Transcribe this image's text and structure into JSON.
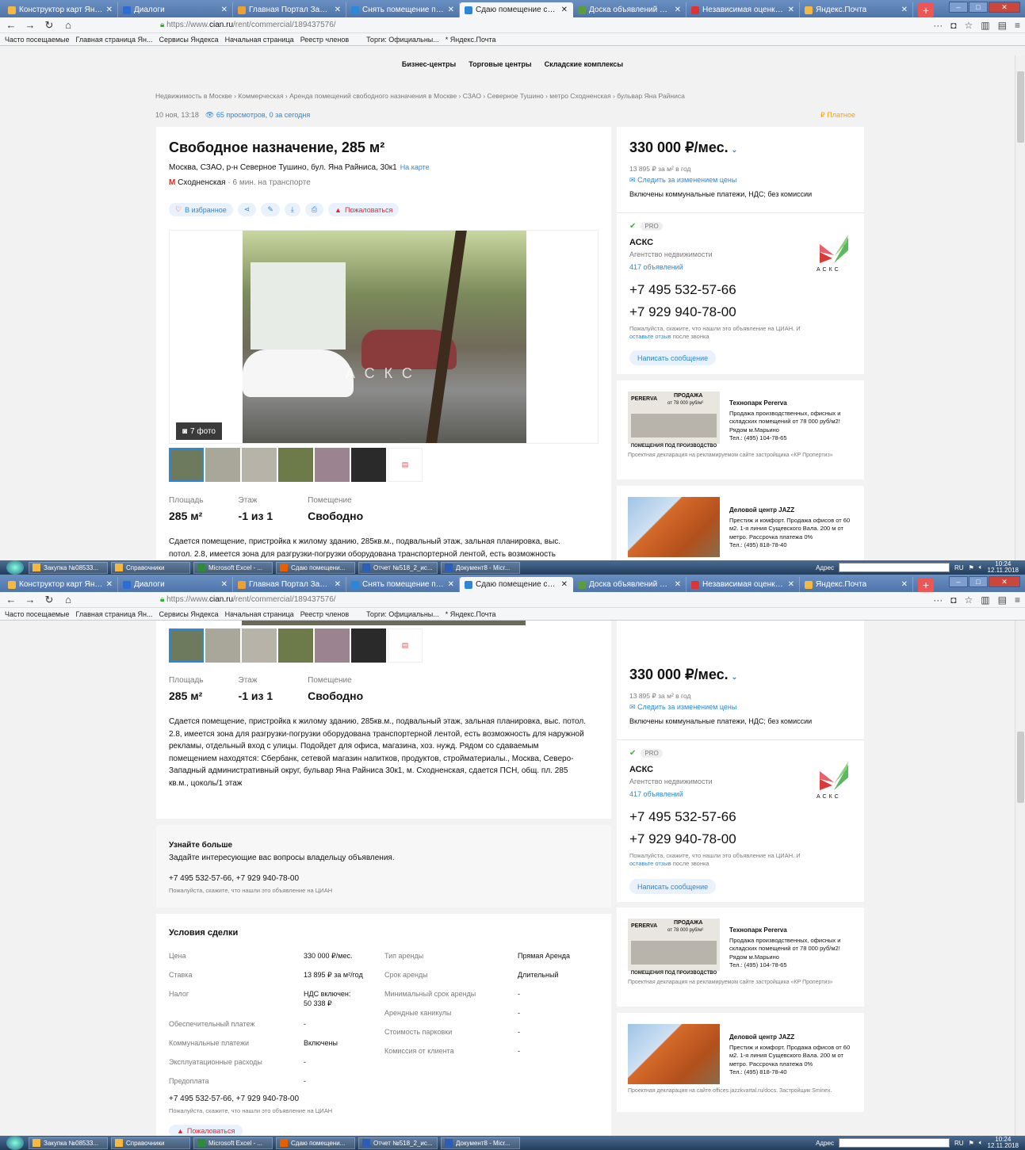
{
  "browser": {
    "tabs": [
      {
        "label": "Конструктор карт Яндекса",
        "color": "#f5b942"
      },
      {
        "label": "Диалоги",
        "color": "#2b6cd6"
      },
      {
        "label": "Главная Портал Закупок",
        "color": "#f0a030"
      },
      {
        "label": "Снять помещение под общ...",
        "color": "#2b87db"
      },
      {
        "label": "Сдаю помещение свободно...",
        "color": "#2b87db"
      },
      {
        "label": "Доска объявлений от частн...",
        "color": "#5a9d3a"
      },
      {
        "label": "Независимая оценка недви...",
        "color": "#d33"
      },
      {
        "label": "Яндекс.Почта",
        "color": "#f5b942"
      }
    ],
    "active_tab": 4,
    "url_prefix": "https://www.",
    "url_domain": "cian.ru",
    "url_path": "/rent/commercial/189437576/",
    "bookmarks": [
      "Часто посещаемые",
      "Главная страница Ян...",
      "Сервисы Яндекса",
      "Начальная страница",
      "Реестр членов",
      "Торги: Официальны...",
      "* Яндекс.Почта"
    ]
  },
  "site_nav": [
    "Бизнес-центры",
    "Торговые центры",
    "Складские комплексы"
  ],
  "breadcrumb": "Недвижимость в Москве  ›  Коммерческая  ›  Аренда помещений свободного назначения в Москве  ›  СЗАО  ›  Северное Тушино  ›  метро Сходненская  ›  бульвар Яна Райниса",
  "meta": {
    "date": "10 ноя, 13:18",
    "views": "65 просмотров, 0 за сегодня",
    "paid": "Платное"
  },
  "listing": {
    "title": "Свободное назначение, 285 м²",
    "address": "Москва, СЗАО, р-н Северное Тушино, бул. Яна Райниса, 30к1",
    "map_link": "На карте",
    "metro": "Сходненская",
    "metro_time": " · 6 мин. на транспорте",
    "actions": {
      "fav": "В избранное",
      "complain": "Пожаловаться"
    },
    "photo_count": "7 фото",
    "watermark": "АСКС",
    "facts": [
      {
        "label": "Площадь",
        "value": "285 м²"
      },
      {
        "label": "Этаж",
        "value": "-1 из 1"
      },
      {
        "label": "Помещение",
        "value": "Свободно"
      }
    ],
    "description_line1": "Сдается помещение, пристройка к жилому зданию, 285кв.м., подвальный этаж, зальная планировка, выс.",
    "description_line2": "потол. 2.8, имеется зона для разгрузки-погрузки оборудована транспортерной лентой, есть возможность",
    "description": "Сдается помещение, пристройка к жилому зданию, 285кв.м., подвальный этаж, зальная планировка, выс. потол. 2.8, имеется зона для разгрузки-погрузки оборудована транспортерной лентой, есть возможность для наружной рекламы, отдельный вход с улицы. Подойдет для офиса, магазина, хоз. нужд. Рядом со сдаваемым помещением находятся: Сбербанк, сетевой магазин напитков, продуктов, стройматериалы., Москва, Северо-Западный административный округ, бульвар Яна Райниса 30к1, м. Сходненская, сдается ПСН, общ. пл. 285 кв.м., цоколь/1 этаж"
  },
  "more_info": {
    "title": "Узнайте больше",
    "text": "Задайте интересующие вас вопросы владельцу объявления.",
    "phones": "+7 495 532-57-66, +7 929 940-78-00",
    "note": "Пожалуйста, скажите, что нашли это объявление на ЦИАН"
  },
  "deal": {
    "title": "Условия сделки",
    "left": [
      {
        "k": "Цена",
        "v": "330 000 ₽/мес."
      },
      {
        "k": "Ставка",
        "v": "13 895 ₽ за м²/год"
      },
      {
        "k": "Налог",
        "v": "НДС включен:",
        "v2": "50 338 ₽"
      },
      {
        "k": "Обеспечительный платеж",
        "v": "-"
      },
      {
        "k": "Коммунальные платежи",
        "v": "Включены"
      },
      {
        "k": "Эксплуатационные расходы",
        "v": "-"
      },
      {
        "k": "Предоплата",
        "v": "-"
      }
    ],
    "right": [
      {
        "k": "Тип аренды",
        "v": "Прямая Аренда"
      },
      {
        "k": "Срок аренды",
        "v": "Длительный"
      },
      {
        "k": "Минимальный срок аренды",
        "v": "-"
      },
      {
        "k": "Арендные каникулы",
        "v": "-"
      },
      {
        "k": "Стоимость парковки",
        "v": "-"
      },
      {
        "k": "Комиссия от клиента",
        "v": "-"
      }
    ],
    "phones": "+7 495 532-57-66, +7 929 940-78-00",
    "note": "Пожалуйста, скажите, что нашли это объявление на ЦИАН",
    "complain": "Пожаловаться"
  },
  "sidebar": {
    "price": "330 000 ₽/мес.",
    "per_m2": "13 895 ₽ за м² в год",
    "watch": "Следить за изменением цены",
    "included": "Включены коммунальные платежи, НДС; без комиссии",
    "pro": "PRO",
    "agency": "АСКС",
    "agency_type": "Агентство недвижимости",
    "agency_count": "417 объявлений",
    "logo_text": "АСКС",
    "phone1": "+7 495 532-57-66",
    "phone2": "+7 929 940-78-00",
    "note_a": "Пожалуйста, скажите, что нашли это объявление на ЦИАН. И ",
    "note_link": "оставьте отзыв",
    "note_b": " после звонка",
    "message": "Написать сообщение"
  },
  "ads": [
    {
      "title": "Технопарк Pererva",
      "text": "Продажа производственных, офисных и складских помещений от 78 000 руб/м2! Рядом м.Марьино",
      "tel": "Тел.: (495) 104-78-65",
      "img_caption": "ПОМЕЩЕНИЯ ПОД ПРОИЗВОДСТВО",
      "img_brand": "PERERVA",
      "img_sale": "ПРОДАЖА",
      "img_price": "от 78 000 руб/м²",
      "foot": "Проектная декларация на рекламируемом сайте застройщика «КР Пропертиз»"
    },
    {
      "title": "Деловой центр JAZZ",
      "text": "Престиж и комфорт. Продажа офисов от 60 м2. 1-я линия Сущевского Вала. 200 м от метро. Рассрочка платежа 0%",
      "tel": "Тел.: (495) 818-78-40",
      "foot": "Проектная декларация на сайте offices.jazzkvartal.ru/docs. Застройщик Sminex."
    }
  ],
  "taskbar": {
    "items": [
      "Закупка №08533...",
      "Справочники",
      "Microsoft Excel - ...",
      "Сдаю помещени...",
      "Отчет №518_2_ис...",
      "Документ8 - Micr..."
    ],
    "address_label": "Адрес",
    "lang": "RU",
    "time": "10:24",
    "date": "12.11.2018"
  }
}
